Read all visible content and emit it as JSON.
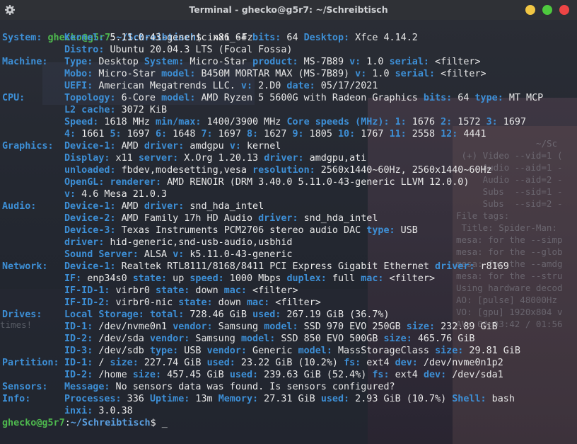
{
  "window": {
    "title": "Terminal - ghecko@g5r7: ~/Schreibtisch",
    "icons": [
      "gear-icon",
      "minimize-icon",
      "maximize-icon",
      "close-icon"
    ],
    "colors": {
      "min": "#f2c744",
      "max": "#4ec93e",
      "close": "#ee4545",
      "keyword": "#3d8fd6"
    }
  },
  "prompt1": {
    "user": "ghecko@g5r7",
    "sep": ":",
    "path": "~/Schreibtisch",
    "cmd": "$ inxi -Fz"
  },
  "out": {
    "system": {
      "l1": [
        "System:",
        "Kernel:",
        " 5.11.0-43-generic x86_64 ",
        "bits:",
        " 64 ",
        "Desktop:",
        " Xfce 4.14.2"
      ],
      "l2": [
        "Distro:",
        " Ubuntu 20.04.3 LTS (Focal Fossa)"
      ]
    },
    "machine": {
      "l1": [
        "Machine:",
        "Type:",
        " Desktop ",
        "System:",
        " Micro-Star ",
        "product:",
        " MS-7B89 ",
        "v:",
        " 1.0 ",
        "serial:",
        " <filter>"
      ],
      "l2": [
        "Mobo:",
        " Micro-Star ",
        "model:",
        " B450M MORTAR MAX (MS-7B89) ",
        "v:",
        " 1.0 ",
        "serial:",
        " <filter>"
      ],
      "l3": [
        "UEFI:",
        " American Megatrends LLC. ",
        "v:",
        " 2.D0 ",
        "date:",
        " 05/17/2021"
      ]
    },
    "cpu": {
      "l1": [
        "CPU:",
        "Topology:",
        " 6-Core ",
        "model:",
        " AMD Ryzen 5 5600G with Radeon Graphics ",
        "bits:",
        " 64 ",
        "type:",
        " MT MCP"
      ],
      "l2": [
        "L2 cache:",
        " 3072 KiB"
      ],
      "l3": [
        "Speed:",
        " 1618 MHz ",
        "min/max:",
        " 1400/3900 MHz ",
        "Core speeds (MHz):",
        " ",
        "1:",
        " 1676 ",
        "2:",
        " 1572 ",
        "3:",
        " 1697"
      ],
      "l4": [
        "4:",
        " 1661 ",
        "5:",
        " 1697 ",
        "6:",
        " 1648 ",
        "7:",
        " 1697 ",
        "8:",
        " 1627 ",
        "9:",
        " 1805 ",
        "10:",
        " 1767 ",
        "11:",
        " 2558 ",
        "12:",
        " 4441"
      ]
    },
    "graphics": {
      "l1": [
        "Graphics:",
        "Device-1:",
        " AMD ",
        "driver:",
        " amdgpu ",
        "v:",
        " kernel"
      ],
      "l2": [
        "Display:",
        " x11 ",
        "server:",
        " X.Org 1.20.13 ",
        "driver:",
        " amdgpu,ati"
      ],
      "l3": [
        "unloaded:",
        " fbdev,modesetting,vesa ",
        "resolution:",
        " 2560x1440~60Hz, 2560x1440~60Hz"
      ],
      "l4": [
        "OpenGL:",
        " ",
        "renderer:",
        " AMD RENOIR (DRM 3.40.0 5.11.0-43-generic LLVM 12.0.0)"
      ],
      "l5": [
        "v:",
        " 4.6 Mesa 21.0.3"
      ]
    },
    "audio": {
      "l1": [
        "Audio:",
        "Device-1:",
        " AMD ",
        "driver:",
        " snd_hda_intel"
      ],
      "l2": [
        "Device-2:",
        " AMD Family 17h HD Audio ",
        "driver:",
        " snd_hda_intel"
      ],
      "l3": [
        "Device-3:",
        " Texas Instruments PCM2706 stereo audio DAC ",
        "type:",
        " USB"
      ],
      "l4": [
        "driver:",
        " hid-generic,snd-usb-audio,usbhid"
      ],
      "l5": [
        "Sound Server:",
        " ALSA ",
        "v:",
        " k5.11.0-43-generic"
      ]
    },
    "network": {
      "l1": [
        "Network:",
        "Device-1:",
        " Realtek RTL8111/8168/8411 PCI Express Gigabit Ethernet ",
        "driver:",
        " r8169"
      ],
      "l2": [
        "IF:",
        " enp34s0 ",
        "state:",
        " up ",
        "speed:",
        " 1000 Mbps ",
        "duplex:",
        " full ",
        "mac:",
        " <filter>"
      ],
      "l3": [
        "IF-ID-1:",
        " virbr0 ",
        "state:",
        " down ",
        "mac:",
        " <filter>"
      ],
      "l4": [
        "IF-ID-2:",
        " virbr0-nic ",
        "state:",
        " down ",
        "mac:",
        " <filter>"
      ]
    },
    "drives": {
      "l1": [
        "Drives:",
        "Local Storage:",
        " ",
        "total:",
        " 728.46 GiB ",
        "used:",
        " 267.19 GiB (36.7%)"
      ],
      "l2": [
        "ID-1:",
        " /dev/nvme0n1 ",
        "vendor:",
        " Samsung ",
        "model:",
        " SSD 970 EVO 250GB ",
        "size:",
        " 232.89 GiB"
      ],
      "l3": [
        "ID-2:",
        " /dev/sda ",
        "vendor:",
        " Samsung ",
        "model:",
        " SSD 850 EVO 500GB ",
        "size:",
        " 465.76 GiB"
      ],
      "l4": [
        "ID-3:",
        " /dev/sdb ",
        "type:",
        " USB ",
        "vendor:",
        " Generic ",
        "model:",
        " MassStorageClass ",
        "size:",
        " 29.81 GiB"
      ]
    },
    "partition": {
      "l1": [
        "Partition:",
        "ID-1:",
        " / ",
        "size:",
        " 227.74 GiB ",
        "used:",
        " 23.22 GiB (10.2%) ",
        "fs:",
        " ext4 ",
        "dev:",
        " /dev/nvme0n1p2"
      ],
      "l2": [
        "ID-2:",
        " /home ",
        "size:",
        " 457.45 GiB ",
        "used:",
        " 239.63 GiB (52.4%) ",
        "fs:",
        " ext4 ",
        "dev:",
        " /dev/sda1"
      ]
    },
    "sensors": {
      "l1": [
        "Sensors:",
        "Message:",
        " No sensors data was found. Is sensors configured?"
      ]
    },
    "info": {
      "l1": [
        "Info:",
        "Processes:",
        " 336 ",
        "Uptime:",
        " 13m ",
        "Memory:",
        " 27.31 GiB ",
        "used:",
        " 2.93 GiB (10.7%) ",
        "Shell:",
        " bash"
      ],
      "l2": [
        "inxi:",
        " 3.0.38"
      ]
    }
  },
  "prompt2": {
    "user": "ghecko@g5r7",
    "sep": ":",
    "path": "~/Schreibtisch",
    "cmd": "$ ",
    "cursor": "_"
  },
  "ghost": {
    "lines": [
      "~/Sc",
      " (+) Video --vid=1 (",
      "     Audio --aid=1 -",
      "     Audio --aid=2 -",
      "     Subs  --sid=1 -",
      "     Subs  --sid=2 -",
      "File tags:",
      " Title: Spider-Man:",
      "mesa: for the --simp",
      "mesa: for the --glob",
      "mesa: for the --amdg",
      "mesa: for the --stru",
      "Using hardware decod",
      "AO: [pulse] 48000Hz",
      "VO: [gpu] 1920x804 v",
      "AV: 00:03:42 / 01:56",
      "times!"
    ]
  }
}
